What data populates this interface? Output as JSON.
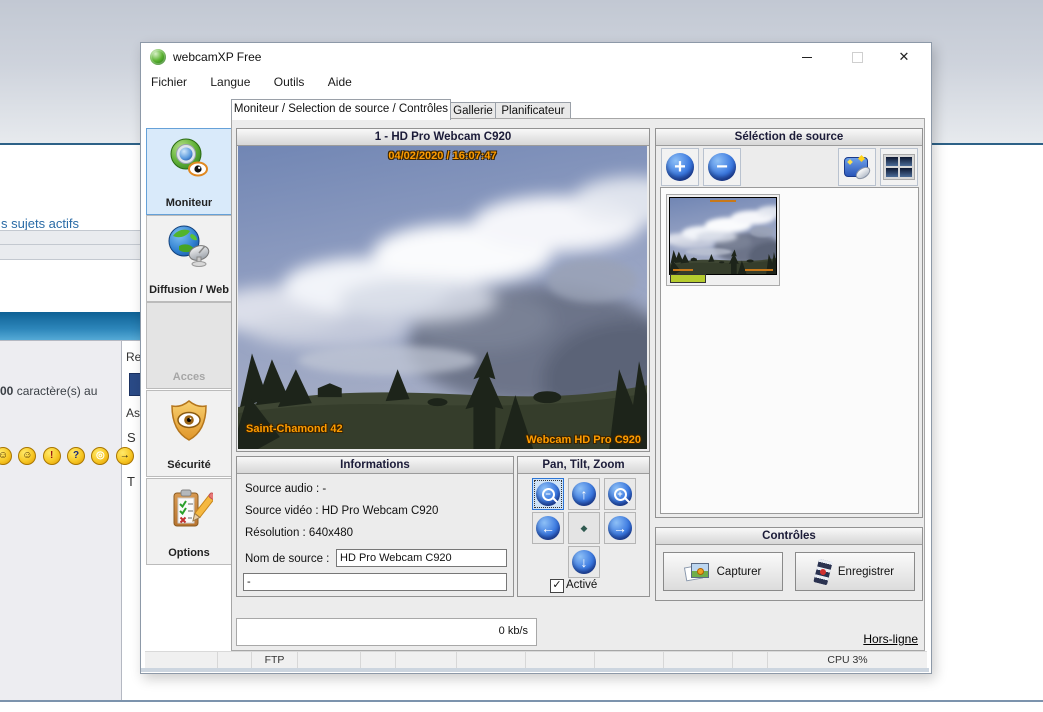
{
  "background": {
    "active_topics_link": "s sujets actifs",
    "char_count_bold": "00",
    "char_count_rest": " caractère(s) au",
    "emoticon_glyphs": [
      "☺",
      "☺",
      "!",
      "?",
      "◎",
      "→"
    ],
    "partial_right": {
      "re": "Re",
      "as": "As",
      "s": "S",
      "t": "T"
    }
  },
  "window": {
    "title": "webcamXP Free",
    "titlebar_buttons": {
      "minimize": "",
      "maximize": "",
      "close": "✕"
    },
    "menu_items": [
      "Fichier",
      "Langue",
      "Outils",
      "Aide"
    ],
    "tabs": [
      "Moniteur / Selection de source / Contrôles",
      "Gallerie",
      "Planificateur"
    ],
    "sidebar": [
      {
        "label": "Moniteur"
      },
      {
        "label": "Diffusion / Web"
      },
      {
        "label": "Acces"
      },
      {
        "label": "Sécurité"
      },
      {
        "label": "Options"
      }
    ],
    "monitor": {
      "header": "1 - HD Pro Webcam C920",
      "timestamp": "04/02/2020 / 16:07:47",
      "overlay_bottom_left": "Saint-Chamond 42",
      "overlay_bottom_right": "Webcam HD Pro C920"
    },
    "informations": {
      "header": "Informations",
      "audio_line": "Source audio : -",
      "video_line": "Source vidéo : HD Pro Webcam C920",
      "resolution_line": "Résolution : 640x480",
      "name_label": "Nom de source :",
      "name_value": "HD Pro Webcam C920",
      "description_value": "-"
    },
    "ptz": {
      "header": "Pan, Tilt, Zoom",
      "checkbox_label": "Activé"
    },
    "source_selection": {
      "header": "Séléction de source"
    },
    "controls": {
      "header": "Contrôles",
      "capture_label": "Capturer",
      "record_label": "Enregistrer"
    },
    "footer": {
      "bandwidth": "0 kb/s",
      "connection_link": "Hors-ligne"
    },
    "statusbar_cells": [
      "",
      "",
      "FTP",
      "",
      "",
      "",
      "",
      "",
      "",
      "",
      "",
      "CPU 3%"
    ]
  },
  "colors": {
    "accent_blue": "#2f6fdc",
    "overlay_orange": "#ff9c00",
    "forum_bar_blue": "#0e6195",
    "selected_sidebar_bg": "#d9eafa"
  }
}
